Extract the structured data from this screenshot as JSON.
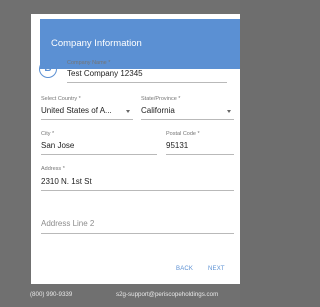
{
  "dialog": {
    "title": "Company Information",
    "icon": "company-badge-icon",
    "icon_glyph": "Ⓑ",
    "accent_color": "#5b90d3"
  },
  "form": {
    "company_name": {
      "label": "Company Name *",
      "value": "Test Company 12345"
    },
    "country": {
      "label": "Select Country *",
      "value": "United States of A..."
    },
    "state": {
      "label": "State/Province *",
      "value": "California"
    },
    "city": {
      "label": "City *",
      "value": "San Jose"
    },
    "postal": {
      "label": "Postal Code *",
      "value": "95131"
    },
    "address": {
      "label": "Address *",
      "value": "2310 N. 1st St"
    },
    "address2": {
      "placeholder": "Address Line 2"
    }
  },
  "actions": {
    "back": "BACK",
    "next": "NEXT"
  },
  "footer": {
    "phone": "(800) 990-9339",
    "email": "s2g-support@periscopeholdings.com"
  }
}
